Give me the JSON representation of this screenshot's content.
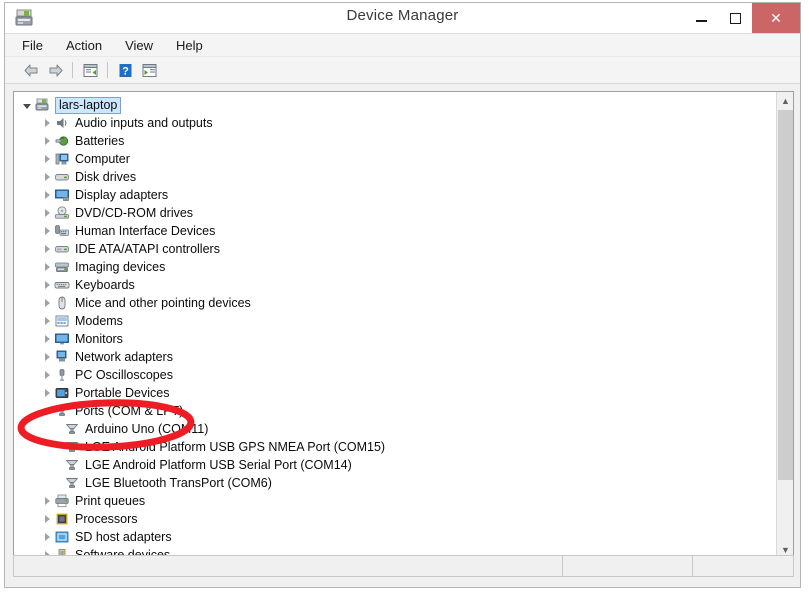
{
  "window": {
    "title": "Device Manager",
    "icon": "device-manager-icon",
    "caption_buttons": {
      "minimize": "Minimize",
      "maximize": "Maximize",
      "close": "Close"
    }
  },
  "menu": {
    "items": [
      {
        "label": "File"
      },
      {
        "label": "Action"
      },
      {
        "label": "View"
      },
      {
        "label": "Help"
      }
    ]
  },
  "toolbar": {
    "buttons": [
      {
        "name": "back-icon",
        "tooltip": "Back"
      },
      {
        "name": "forward-icon",
        "tooltip": "Forward"
      },
      {
        "name": "properties-icon",
        "tooltip": "Properties"
      },
      {
        "name": "help-icon",
        "tooltip": "Help"
      },
      {
        "name": "scan-hardware-icon",
        "tooltip": "Scan for hardware changes"
      }
    ]
  },
  "tree": {
    "root": {
      "label": "lars-laptop",
      "icon": "computer-icon",
      "expanded": true,
      "selected": true
    },
    "nodes": [
      {
        "label": "Audio inputs and outputs",
        "icon": "speaker-icon",
        "level": 1,
        "expanded": false
      },
      {
        "label": "Batteries",
        "icon": "battery-icon",
        "level": 1,
        "expanded": false
      },
      {
        "label": "Computer",
        "icon": "computer-node-icon",
        "level": 1,
        "expanded": false
      },
      {
        "label": "Disk drives",
        "icon": "disk-drive-icon",
        "level": 1,
        "expanded": false
      },
      {
        "label": "Display adapters",
        "icon": "display-adapter-icon",
        "level": 1,
        "expanded": false
      },
      {
        "label": "DVD/CD-ROM drives",
        "icon": "dvd-drive-icon",
        "level": 1,
        "expanded": false
      },
      {
        "label": "Human Interface Devices",
        "icon": "hid-icon",
        "level": 1,
        "expanded": false
      },
      {
        "label": "IDE ATA/ATAPI controllers",
        "icon": "ide-controller-icon",
        "level": 1,
        "expanded": false
      },
      {
        "label": "Imaging devices",
        "icon": "imaging-device-icon",
        "level": 1,
        "expanded": false
      },
      {
        "label": "Keyboards",
        "icon": "keyboard-icon",
        "level": 1,
        "expanded": false
      },
      {
        "label": "Mice and other pointing devices",
        "icon": "mouse-icon",
        "level": 1,
        "expanded": false
      },
      {
        "label": "Modems",
        "icon": "modem-icon",
        "level": 1,
        "expanded": false
      },
      {
        "label": "Monitors",
        "icon": "monitor-icon",
        "level": 1,
        "expanded": false
      },
      {
        "label": "Network adapters",
        "icon": "network-adapter-icon",
        "level": 1,
        "expanded": false
      },
      {
        "label": "PC Oscilloscopes",
        "icon": "oscilloscope-icon",
        "level": 1,
        "expanded": false
      },
      {
        "label": "Portable Devices",
        "icon": "portable-device-icon",
        "level": 1,
        "expanded": false
      },
      {
        "label": "Ports (COM & LPT)",
        "icon": "port-icon",
        "level": 1,
        "expanded": true
      },
      {
        "label": "Arduino Uno (COM11)",
        "icon": "port-icon",
        "level": 2,
        "expanded": false
      },
      {
        "label": "LGE Android Platform USB GPS NMEA Port (COM15)",
        "icon": "port-icon",
        "level": 2,
        "expanded": false
      },
      {
        "label": "LGE Android Platform USB Serial Port (COM14)",
        "icon": "port-icon",
        "level": 2,
        "expanded": false
      },
      {
        "label": "LGE Bluetooth TransPort (COM6)",
        "icon": "port-icon",
        "level": 2,
        "expanded": false
      },
      {
        "label": "Print queues",
        "icon": "printer-icon",
        "level": 1,
        "expanded": false
      },
      {
        "label": "Processors",
        "icon": "processor-icon",
        "level": 1,
        "expanded": false
      },
      {
        "label": "SD host adapters",
        "icon": "sd-adapter-icon",
        "level": 1,
        "expanded": false
      },
      {
        "label": "Software devices",
        "icon": "software-device-icon",
        "level": 1,
        "expanded": false
      }
    ]
  },
  "scrollbar": {
    "up_arrow": "▲",
    "down_arrow": "▼"
  },
  "annotation": {
    "shape": "ellipse",
    "color": "#ee1c25",
    "target_label": "Arduino Uno (COM11)"
  },
  "statusbar": {
    "cells": [
      "",
      "",
      ""
    ]
  }
}
